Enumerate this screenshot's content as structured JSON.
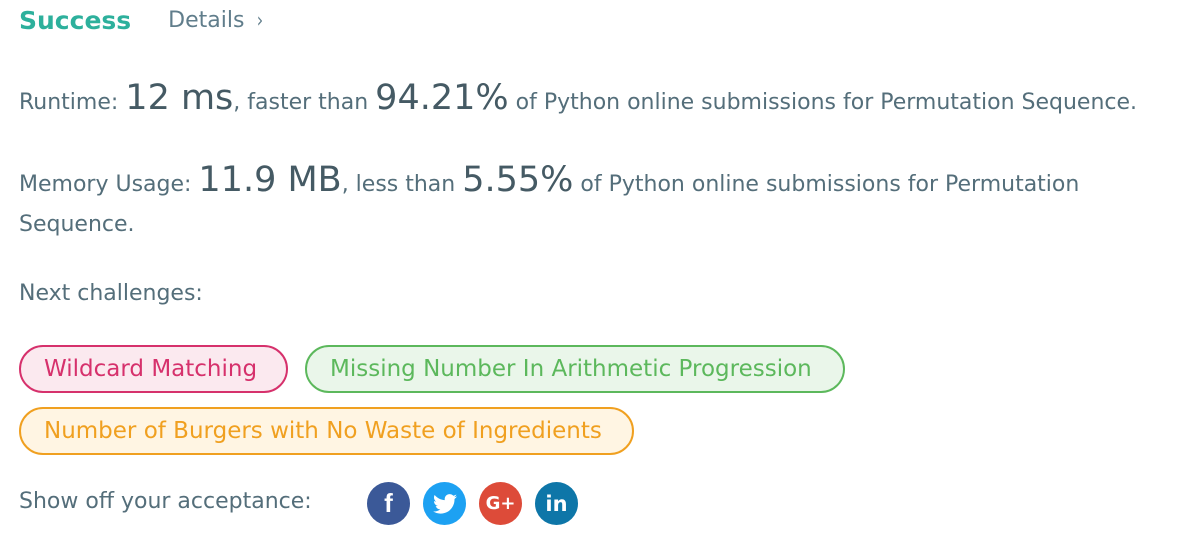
{
  "header": {
    "status": "Success",
    "details_label": "Details",
    "chevron": "›"
  },
  "runtime": {
    "label": "Runtime: ",
    "value": "12 ms",
    "mid": ", faster than ",
    "percent": "94.21%",
    "suffix": " of Python online submissions for Permutation Sequence."
  },
  "memory": {
    "label": "Memory Usage: ",
    "value": "11.9 MB",
    "mid": ", less than ",
    "percent": "5.55%",
    "suffix": " of Python online submissions for Permutation Sequence."
  },
  "next": {
    "label": "Next challenges:",
    "challenges": [
      {
        "title": "Wildcard Matching",
        "difficulty_color": "#d6316c"
      },
      {
        "title": "Missing Number In Arithmetic Progression",
        "difficulty_color": "#5cb85c"
      },
      {
        "title": "Number of Burgers with No Waste of Ingredients",
        "difficulty_color": "#f0a020"
      }
    ]
  },
  "share": {
    "label": "Show off your acceptance:",
    "icons": [
      {
        "name": "facebook-icon",
        "glyph": "f",
        "color": "#3b5998"
      },
      {
        "name": "twitter-icon",
        "glyph": "",
        "color": "#1da1f2"
      },
      {
        "name": "google-plus-icon",
        "glyph": "G+",
        "color": "#dd4b39"
      },
      {
        "name": "linkedin-icon",
        "glyph": "in",
        "color": "#0e76a8"
      }
    ]
  }
}
